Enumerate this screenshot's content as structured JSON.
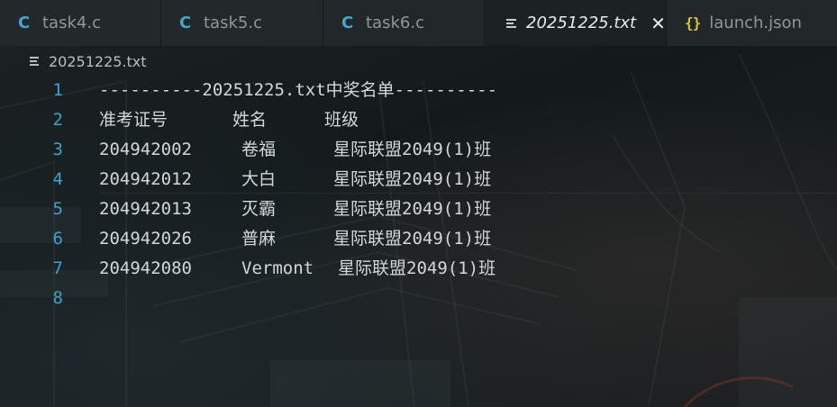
{
  "tabs": [
    {
      "icon": "c-file-icon",
      "glyph": "C",
      "label": "task4.c"
    },
    {
      "icon": "c-file-icon",
      "glyph": "C",
      "label": "task5.c"
    },
    {
      "icon": "c-file-icon",
      "glyph": "C",
      "label": "task6.c"
    },
    {
      "icon": "text-file-icon",
      "label": "20251225.txt",
      "active": true,
      "close": "✕"
    },
    {
      "icon": "json-file-icon",
      "glyph": "{}",
      "label": "launch.json"
    }
  ],
  "breadcrumb": {
    "label": "20251225.txt"
  },
  "editor": {
    "lines": [
      {
        "number": "1",
        "text": "----------20251225.txt中奖名单----------"
      },
      {
        "number": "2",
        "cols": [
          "准考证号",
          "姓名",
          "班级"
        ]
      },
      {
        "number": "3",
        "cols": [
          "204942002",
          "卷福",
          "星际联盟2049(1)班"
        ]
      },
      {
        "number": "4",
        "cols": [
          "204942012",
          "大白",
          "星际联盟2049(1)班"
        ]
      },
      {
        "number": "5",
        "cols": [
          "204942013",
          "灭霸",
          "星际联盟2049(1)班"
        ]
      },
      {
        "number": "6",
        "cols": [
          "204942026",
          "普麻",
          "星际联盟2049(1)班"
        ]
      },
      {
        "number": "7",
        "cols": [
          "204942080",
          "Vermont",
          "星际联盟2049(1)班"
        ]
      },
      {
        "number": "8",
        "text": ""
      }
    ]
  },
  "colors": {
    "line_number": "#3ea1cf",
    "text": "#d4d7d8",
    "c_icon": "#4aa3c8",
    "json_icon": "#d7c14a"
  }
}
